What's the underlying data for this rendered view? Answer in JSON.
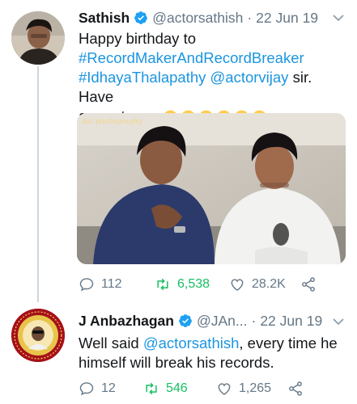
{
  "tweets": [
    {
      "display_name": "Sathish",
      "handle": "@actorsathish",
      "separator": "·",
      "date": "22 Jun 19",
      "text_plain": "Happy birthday to",
      "hashtag1": "#RecordMakerAndRecordBreaker",
      "hashtag2": "#IdhayaThalapathy",
      "mention": "@actorvijay",
      "text_after_mention": " sir. Have",
      "text_last": "a great year",
      "emojis": [
        "hugging-face",
        "hugging-face",
        "heart-eyes",
        "heart-eyes",
        "face-blowing-kiss",
        "face-blowing-kiss"
      ],
      "media_watermark": "Asi photography",
      "replies": "112",
      "retweets": "6,538",
      "likes": "28.2K"
    },
    {
      "display_name": "J Anbazhagan",
      "handle": "@JAn...",
      "separator": "·",
      "date": "22 Jun 19",
      "text_before": "Well said ",
      "mention": "@actorsathish",
      "text_after": ", every time he",
      "text_line2": "himself will break his records.",
      "replies": "12",
      "retweets": "546",
      "likes": "1,265"
    }
  ],
  "colors": {
    "link": "#1b95e0",
    "secondary": "#657786",
    "retweet": "#17bf63",
    "verified": "#1da1f2"
  },
  "icons": [
    "reply-icon",
    "retweet-icon",
    "like-icon",
    "share-icon",
    "verified-badge-icon",
    "chevron-down-icon"
  ]
}
